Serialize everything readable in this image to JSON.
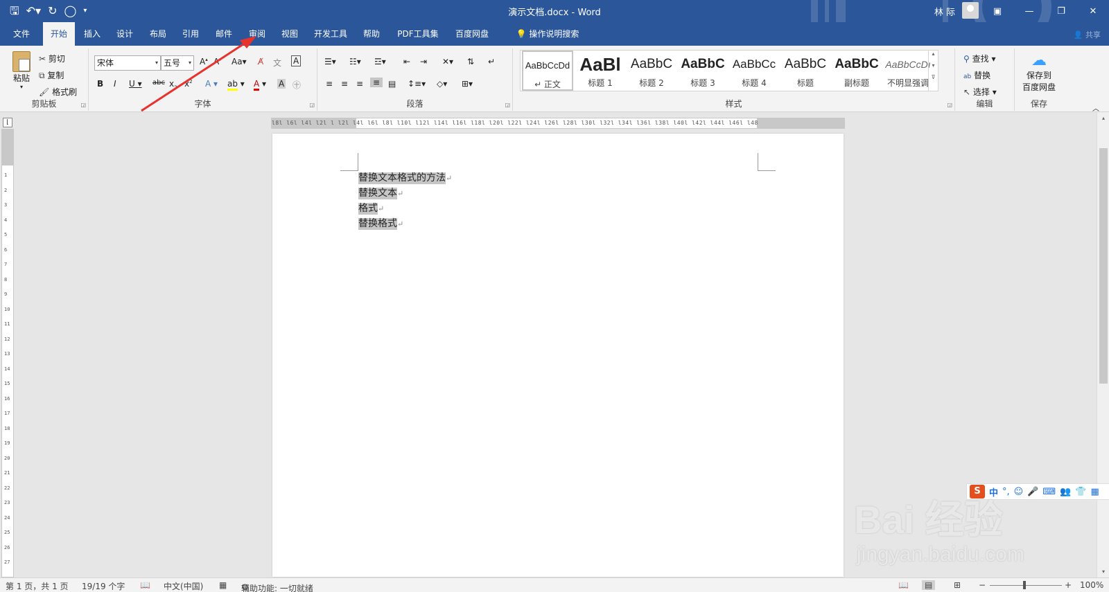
{
  "app": {
    "title": "演示文档.docx  -  Word",
    "user": "林 际",
    "share_label": "共享",
    "accent_color": "#2b579a"
  },
  "quick_access": [
    "save-icon",
    "undo-icon",
    "redo-icon",
    "circle-icon",
    "customize-icon"
  ],
  "tabs": [
    "文件",
    "开始",
    "插入",
    "设计",
    "布局",
    "引用",
    "邮件",
    "审阅",
    "视图",
    "开发工具",
    "帮助",
    "PDF工具集",
    "百度网盘"
  ],
  "active_tab": "开始",
  "tell_me": "操作说明搜索",
  "ribbon": {
    "clipboard": {
      "paste": "粘贴",
      "cut": "剪切",
      "copy": "复制",
      "format_painter": "格式刷",
      "label": "剪贴板"
    },
    "font": {
      "name": "宋体",
      "size": "五号",
      "label": "字体",
      "case_btn": "Aa"
    },
    "paragraph": {
      "label": "段落"
    },
    "styles": {
      "label": "样式",
      "items": [
        {
          "preview": "AaBbCcDd",
          "name": "↵ 正文"
        },
        {
          "preview": "AaBl",
          "name": "标题 1"
        },
        {
          "preview": "AaBbC",
          "name": "标题 2"
        },
        {
          "preview": "AaBbC",
          "name": "标题 3"
        },
        {
          "preview": "AaBbCc",
          "name": "标题 4"
        },
        {
          "preview": "AaBbC",
          "name": "标题"
        },
        {
          "preview": "AaBbC",
          "name": "副标题"
        },
        {
          "preview": "AaBbCcDı",
          "name": "不明显强调"
        }
      ]
    },
    "editing": {
      "find": "查找",
      "replace": "替换",
      "select": "选择",
      "label": "编辑"
    },
    "save": {
      "btn_line1": "保存到",
      "btn_line2": "百度网盘",
      "label": "保存"
    }
  },
  "document": {
    "lines": [
      "替换文本格式的方法",
      "替换文本",
      "格式",
      "替换格式"
    ],
    "para_mark": "↵"
  },
  "ruler": {
    "h_ticks": "l8l  l6l  l4l  l2l  l    l2l  l4l  l6l  l8l  l10l  l12l  l14l  l16l  l18l  l20l  l22l  l24l  l26l  l28l  l30l  l32l  l34l  l36l  l38l  l40l  l42l  l44l  l46l  l48",
    "v_nums": [
      "1",
      "2",
      "3",
      "4",
      "5",
      "6",
      "7",
      "8",
      "9",
      "10",
      "11",
      "12",
      "13",
      "14",
      "15",
      "16",
      "17",
      "18",
      "19",
      "20",
      "21",
      "22",
      "23",
      "24",
      "25",
      "26",
      "27"
    ]
  },
  "status": {
    "page": "第 1 页，共 1 页",
    "words": "19/19 个字",
    "language": "中文(中国)",
    "accessibility": "辅助功能: 一切就绪",
    "zoom": "100%",
    "zoom_fraction": 0.5
  },
  "ime": {
    "logo": "S",
    "mode": "中",
    "punct": "°,"
  },
  "watermark": {
    "big": "Bai 经验",
    "small": "jingyan.baidu.com"
  }
}
